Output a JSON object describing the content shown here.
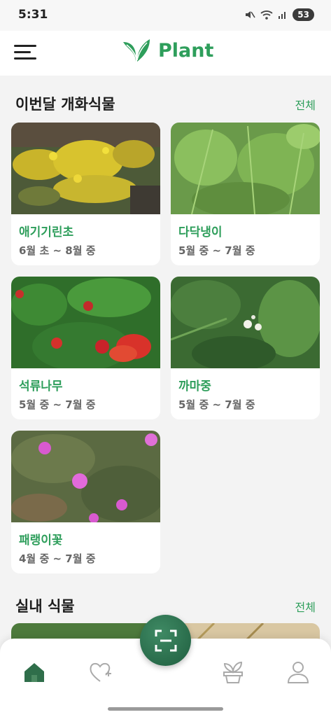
{
  "status_bar": {
    "time": "5:31",
    "battery": "53"
  },
  "app_bar": {
    "title": "Plant"
  },
  "sections": [
    {
      "title": "이번달 개화식물",
      "see_all": "전체"
    },
    {
      "title": "실내 식물",
      "see_all": "전체"
    }
  ],
  "flowering_plants": [
    {
      "name": "애기기린초",
      "period": "6월 초 ~ 8월 중"
    },
    {
      "name": "다닥냉이",
      "period": "5월 중 ~ 7월 중"
    },
    {
      "name": "석류나무",
      "period": "5월 중 ~ 7월 중"
    },
    {
      "name": "까마중",
      "period": "5월 중 ~ 7월 중"
    },
    {
      "name": "패랭이꽃",
      "period": "4월 중 ~ 7월 중"
    }
  ],
  "bottom_nav": [
    {
      "icon": "home-icon",
      "active": true
    },
    {
      "icon": "heart-plus-icon",
      "active": false
    },
    {
      "icon": "scan-icon",
      "active": false
    },
    {
      "icon": "plant-pot-icon",
      "active": false
    },
    {
      "icon": "user-icon",
      "active": false
    }
  ],
  "colors": {
    "accent": "#2e9e5b",
    "scan_button": "#2b6e4c",
    "background": "#f3f3f3"
  }
}
